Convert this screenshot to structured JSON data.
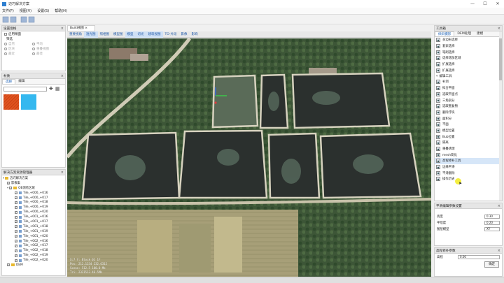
{
  "app": {
    "title": "迈巧解决方案"
  },
  "menu": [
    "文件(F)",
    "视图(V)",
    "设置(S)",
    "帮助(H)"
  ],
  "view_tabs": [
    {
      "label": "重要视角",
      "active": false
    },
    {
      "label": "透光图",
      "active": true
    },
    {
      "label": "照相图",
      "active": false
    },
    {
      "label": "模型图",
      "active": false
    },
    {
      "label": "模型",
      "active": true
    },
    {
      "label": "切光",
      "active": true
    },
    {
      "label": "建筑视图",
      "active": true
    },
    {
      "label": "TO-片段",
      "active": false
    },
    {
      "label": "影像",
      "active": false
    },
    {
      "label": "影响",
      "active": false
    }
  ],
  "left_panel_top": {
    "title": "设置窗格",
    "checkbox": "启用精面",
    "section": "筛选",
    "radios": [
      {
        "a": "自然",
        "b": "平均"
      },
      {
        "a": "区块",
        "b": "重叠视图"
      },
      {
        "a": "最近",
        "b": "最佳"
      }
    ]
  },
  "material": {
    "title": "材质",
    "tabs": [
      "选择",
      "编辑"
    ],
    "colors": [
      "#e0531f",
      "#35b8ef"
    ]
  },
  "tree": {
    "title": "解决方案资源管理器",
    "root": "迈巧解决方案",
    "layer": "影像集",
    "group": "OB测绘区域",
    "items": [
      "Tile_+000_+016",
      "Tile_+000_+017",
      "Tile_+000_+018",
      "Tile_+000_+019",
      "Tile_+000_+020",
      "Tile_+001_+016",
      "Tile_+001_+017",
      "Tile_+001_+018",
      "Tile_+001_+019",
      "Tile_+001_+020",
      "Tile_+002_+016",
      "Tile_+002_+017",
      "Tile_+002_+018",
      "Tile_+002_+019",
      "Tile_+002_+020"
    ],
    "last": "DEM"
  },
  "toolbox": {
    "title": "工具箱",
    "tabs": [
      "倾斜摄影",
      "DEM处理",
      "建模"
    ],
    "tools_a": [
      "多边形选择",
      "套索选择",
      "笔刷选择",
      "选择增加区域",
      "扩展选择",
      "扩展选择"
    ],
    "section": "编辑工具",
    "tools_b": [
      "补洞",
      "拟合平面",
      "选取平面点",
      "三角剖分",
      "选取重复物",
      "删除浮块",
      "面积分",
      "平面",
      "模型位置",
      "Bub位置",
      "隔离",
      "重叠清理",
      "mesh简化",
      "高程修补工具",
      "边缘平滑",
      "平滑删除",
      "操作历史"
    ],
    "selected": "高程修补工具"
  },
  "props": {
    "title": "平滑编辑参数设置",
    "fields": [
      {
        "label": "高度",
        "value": "0.30"
      },
      {
        "label": "平坦度",
        "value": "0.20"
      },
      {
        "label": "图层模型",
        "value": "XY"
      }
    ]
  },
  "props2": {
    "title": "高程修补参数",
    "fields": [
      {
        "label": "高程",
        "value": "0.00"
      }
    ],
    "button": "确定"
  },
  "overlay": {
    "lines": [
      "X:7 Y:  Block 01 1F",
      "Pos: 212.1234 232.6312",
      "Scene: 512.5 100.0 Mb",
      "Tri: 2321513 46.5Mb"
    ]
  },
  "colors": {
    "accent": "#1a5fb4",
    "selection": "#d6e6f8",
    "water": "#2b302e",
    "highlight": "#f0e800"
  }
}
